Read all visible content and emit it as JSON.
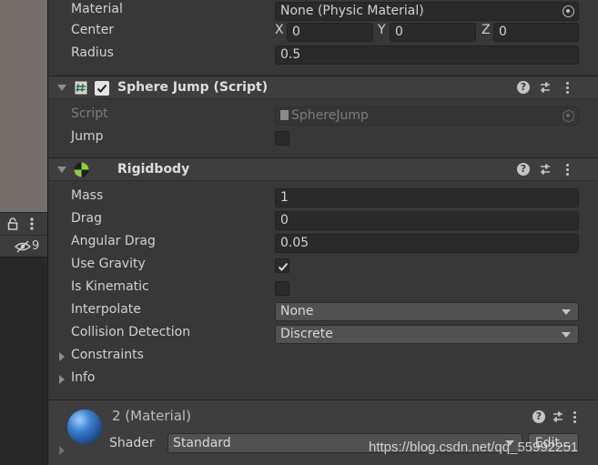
{
  "left_panel": {
    "hidden_count": "9"
  },
  "collider": {
    "material_label": "Material",
    "material_value": "None (Physic Material)",
    "center_label": "Center",
    "center": {
      "x_label": "X",
      "x": "0",
      "y_label": "Y",
      "y": "0",
      "z_label": "Z",
      "z": "0"
    },
    "radius_label": "Radius",
    "radius_value": "0.5"
  },
  "sphere_jump": {
    "title": "Sphere Jump (Script)",
    "script_label": "Script",
    "script_value": "SphereJump",
    "jump_label": "Jump",
    "jump_checked": false
  },
  "rigidbody": {
    "title": "Rigidbody",
    "mass_label": "Mass",
    "mass_value": "1",
    "drag_label": "Drag",
    "drag_value": "0",
    "angular_drag_label": "Angular Drag",
    "angular_drag_value": "0.05",
    "use_gravity_label": "Use Gravity",
    "use_gravity_checked": true,
    "is_kinematic_label": "Is Kinematic",
    "is_kinematic_checked": false,
    "interpolate_label": "Interpolate",
    "interpolate_value": "None",
    "collision_detection_label": "Collision Detection",
    "collision_detection_value": "Discrete",
    "constraints_label": "Constraints",
    "info_label": "Info"
  },
  "material": {
    "title": "2 (Material)",
    "shader_label": "Shader",
    "shader_value": "Standard",
    "edit_label": "Edit..."
  },
  "watermark": "https://blog.csdn.net/qq_55992251",
  "colors": {
    "panel_bg": "#383838",
    "header_bg": "#3e3e3e",
    "field_bg": "#2a2a2a",
    "dropdown_bg": "#515151",
    "scene_bg": "#756f6b"
  }
}
